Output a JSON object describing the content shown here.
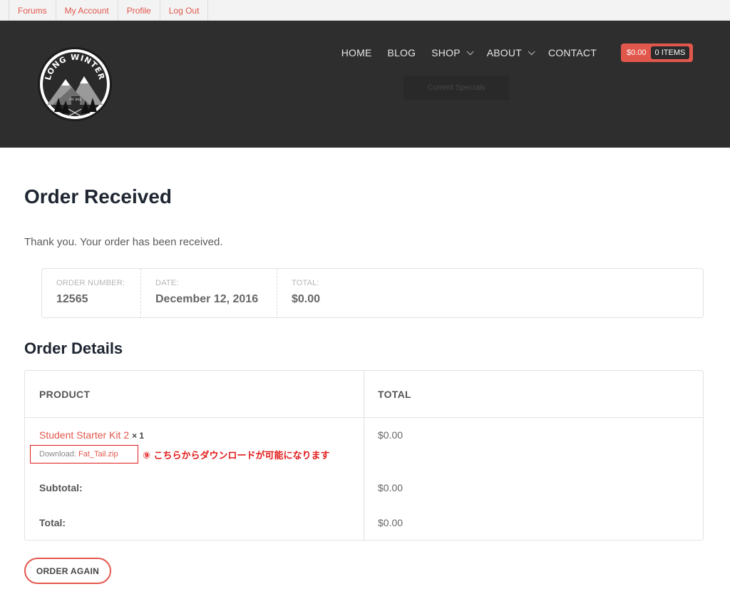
{
  "topbar": {
    "links": [
      "Forums",
      "My Account",
      "Profile",
      "Log Out"
    ]
  },
  "header": {
    "logo_text": "LONG WINTER",
    "logo_subtext": "FAT BIKE",
    "nav": {
      "home": "HOME",
      "blog": "BLOG",
      "shop": "SHOP",
      "about": "ABOUT",
      "contact": "CONTACT"
    },
    "cart": {
      "amount": "$0.00",
      "items": "0 ITEMS"
    },
    "specials_label": "Current Specials"
  },
  "page": {
    "title": "Order Received",
    "thanks": "Thank you. Your order has been received."
  },
  "summary": {
    "order_number_label": "ORDER NUMBER:",
    "order_number": "12565",
    "date_label": "DATE:",
    "date": "December 12, 2016",
    "total_label": "TOTAL:",
    "total": "$0.00"
  },
  "details": {
    "title": "Order Details",
    "col_product": "PRODUCT",
    "col_total": "TOTAL",
    "product_name": "Student Starter Kit 2",
    "product_qty": "× 1",
    "product_total": "$0.00",
    "download_label": "Download:",
    "download_file": "Fat_Tail.zip",
    "annotation": "⑨ こちらからダウンロードが可能になります",
    "subtotal_label": "Subtotal:",
    "subtotal": "$0.00",
    "total_label": "Total:",
    "total": "$0.00"
  },
  "actions": {
    "order_again": "ORDER AGAIN"
  },
  "colors": {
    "accent": "#e2574c",
    "header_bg": "#2e2e2e",
    "annotation": "#e21b1b"
  }
}
